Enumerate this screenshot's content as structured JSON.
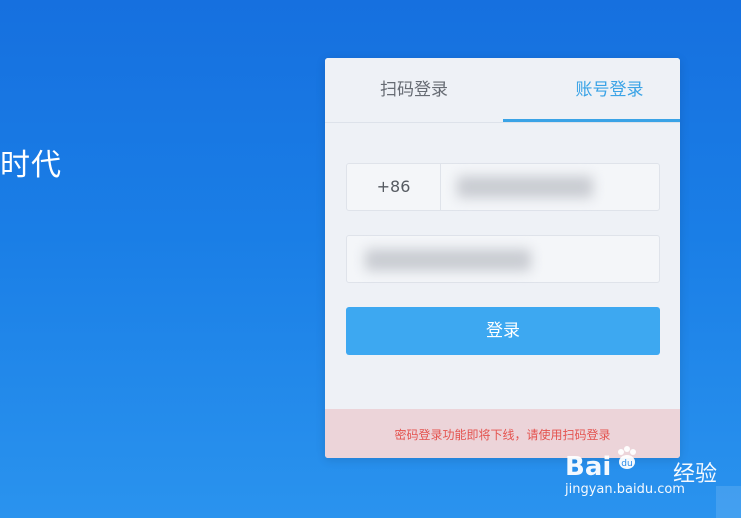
{
  "hero": {
    "text": "时代"
  },
  "tabs": {
    "qr_login": "扫码登录",
    "account_login": "账号登录",
    "active": "account_login"
  },
  "form": {
    "country_code": "+86",
    "login_button": "登录"
  },
  "notice": {
    "text": "密码登录功能即将下线，请使用扫码登录"
  },
  "watermark": {
    "logo": "Bai",
    "logo_suffix": "经验",
    "url": "jingyan.baidu.com"
  },
  "colors": {
    "background": "#1a7ee6",
    "accent": "#3aa3e6",
    "button": "#3da8f1",
    "notice_bg": "#ecd4d9",
    "notice_text": "#e4534f"
  }
}
